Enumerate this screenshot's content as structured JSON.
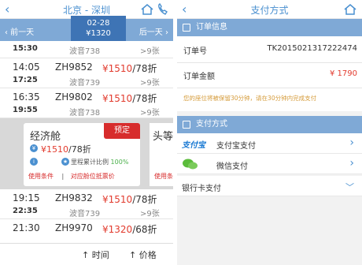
{
  "left": {
    "header": {
      "title": "北京 - 深圳",
      "back": "‹"
    },
    "datebar": {
      "prev": "‹ 前一天",
      "date": "02-28",
      "price": "¥1320",
      "next": "后一天 ›"
    },
    "rows_top": [
      {
        "time": "15:30",
        "plane": "波音738",
        "seats": ">9张",
        "partial": true
      }
    ],
    "rows": [
      {
        "dep": "14:05",
        "arr": "17:25",
        "flight": "ZH9852",
        "plane": "波音739",
        "price": "¥1510",
        "discount": "/78折",
        "seats": ">9张"
      },
      {
        "dep": "16:35",
        "arr": "19:55",
        "flight": "ZH9802",
        "plane": "波音738",
        "price": "¥1510",
        "discount": "/78折",
        "seats": ">9张"
      }
    ],
    "cabin": {
      "name": "经济舱",
      "book": "预定",
      "price": "¥1510",
      "discount": "/78折",
      "mileage_label": "里程累计比例",
      "mileage_value": "100%",
      "link1": "使用条件",
      "link2": "对应舱位抵票价",
      "side_name": "头等",
      "side_link": "使用条"
    },
    "rows_bottom": [
      {
        "dep": "19:15",
        "arr": "22:35",
        "flight": "ZH9832",
        "plane": "波音739",
        "price": "¥1510",
        "discount": "/78折",
        "seats": ">9张"
      },
      {
        "dep": "21:30",
        "arr": "",
        "flight": "ZH9970",
        "plane": "",
        "price": "¥1320",
        "discount": "/68折",
        "seats": ""
      }
    ],
    "footer": {
      "time": "↑ 时间",
      "price": "↑ 价格"
    }
  },
  "right": {
    "header": {
      "title": "支付方式",
      "back": "‹"
    },
    "order_section": "订单信息",
    "order_no_label": "订单号",
    "order_no": "TK2015021317222474",
    "amount_label": "订单金额",
    "amount": "¥ 1790",
    "note": "您的座位将被保留30分钟，请在30分钟内完成支付",
    "pay_section": "支付方式",
    "pay_options": [
      {
        "logo": "支付宝",
        "label": "支付宝支付"
      },
      {
        "logo": "wechat",
        "label": "微信支付"
      }
    ],
    "bank": "银行卡支付"
  },
  "colors": {
    "accent": "#4a90d0",
    "bar": "#7fa9d6",
    "red": "#e23b2e"
  }
}
